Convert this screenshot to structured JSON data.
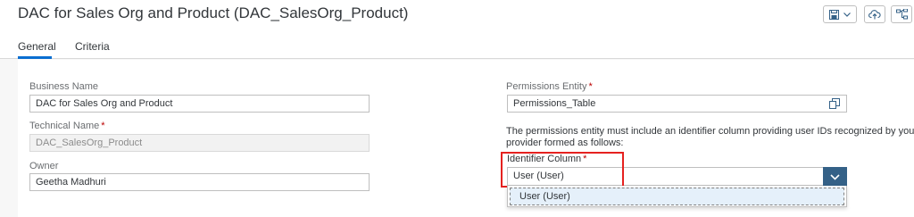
{
  "header": {
    "title": "DAC for Sales Org and Product (DAC_SalesOrg_Product)",
    "tabs": [
      {
        "label": "General"
      },
      {
        "label": "Criteria"
      }
    ]
  },
  "form": {
    "business_name": {
      "label": "Business Name",
      "value": "DAC for Sales Org and Product"
    },
    "technical_name": {
      "label": "Technical Name",
      "required_mark": "*",
      "value": "DAC_SalesOrg_Product"
    },
    "owner": {
      "label": "Owner",
      "value": "Geetha Madhuri"
    },
    "permissions_entity": {
      "label": "Permissions Entity",
      "required_mark": "*",
      "value": "Permissions_Table"
    },
    "info_text_line1": "The permissions entity must include an identifier column providing user IDs recognized by your",
    "info_text_line2": "provider formed as follows:",
    "identifier_column": {
      "label": "Identifier Column",
      "required_mark": "*",
      "value": "User (User)"
    },
    "dropdown_options": [
      "User (User)"
    ]
  },
  "colors": {
    "accent": "#0a6ed1",
    "required": "#bb0000",
    "highlight_box": "#e5211f",
    "select_button": "#346187"
  }
}
